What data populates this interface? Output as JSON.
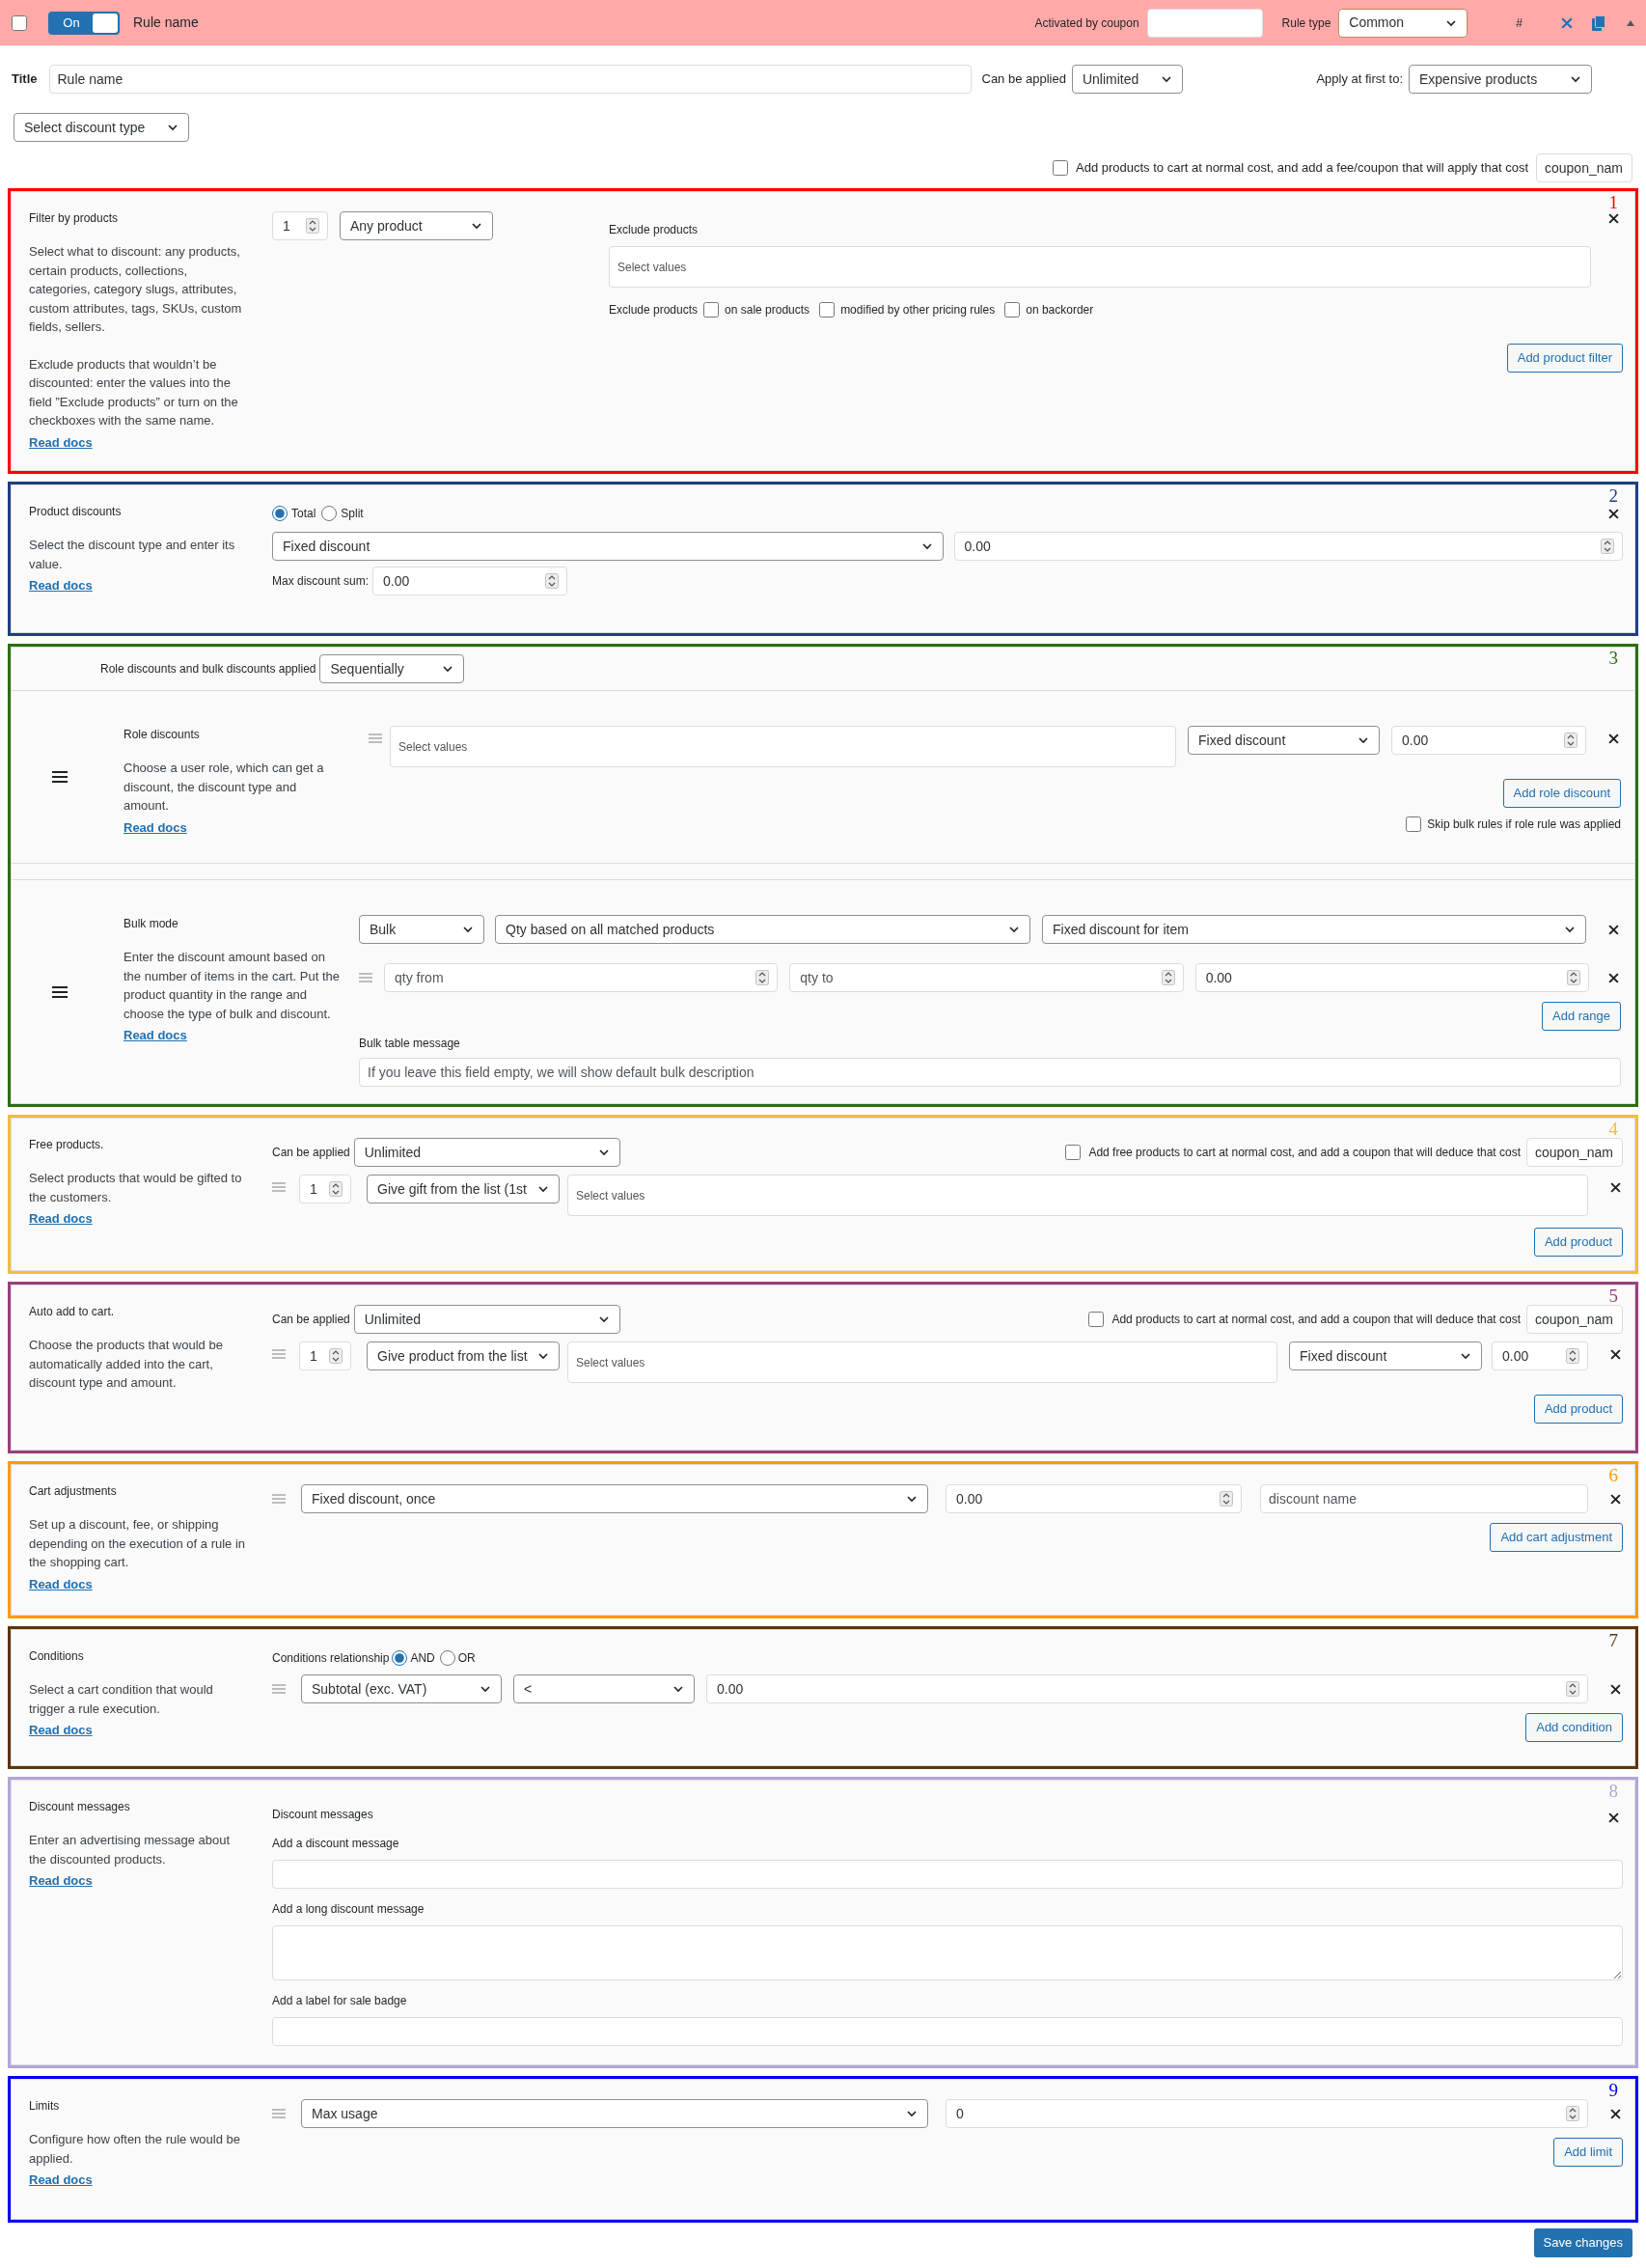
{
  "header": {
    "checked": false,
    "toggle": {
      "label": "On",
      "on": true
    },
    "rule_name": "Rule name",
    "coupon_label": "Activated by coupon",
    "rule_type_label": "Rule type",
    "rule_type": "Common",
    "hash": "#"
  },
  "title_row": {
    "label": "Title",
    "value": "Rule name",
    "can_be_applied_label": "Can be applied",
    "can_be_applied": "Unlimited",
    "apply_first_label": "Apply at first to:",
    "apply_first": "Expensive products"
  },
  "discount_type_select": "Select discount type",
  "cart_cost_option": {
    "checked": false,
    "label": "Add products to cart at normal cost, and add a fee/coupon that will apply that cost",
    "coupon_value": "coupon_nam"
  },
  "sections": [
    {
      "kind": "filter",
      "number": "1",
      "color": "#ff0000",
      "title": "Filter by products",
      "description": [
        "Select what to discount: any products, certain products, collections, categories, category slugs, attributes, custom attributes, tags, SKUs, custom fields, sellers.",
        "Exclude products that wouldn’t be discounted: enter the values into the field ”Exclude products” or turn on the checkboxes with the same name."
      ],
      "link": "Read docs",
      "quantity": "1",
      "product_select": "Any product",
      "exclude_label": "Exclude products",
      "exclude_field": {
        "placeholder": "Select values"
      },
      "exclude_options_label": "Exclude products",
      "exclude_options": [
        {
          "label": "on sale products",
          "checked": false
        },
        {
          "label": "modified by other pricing rules",
          "checked": false
        },
        {
          "label": "on backorder",
          "checked": false
        }
      ],
      "button": "Add product filter"
    },
    {
      "kind": "product_discount",
      "number": "2",
      "color": "#1e3f82",
      "title": "Product discounts",
      "description": [
        "Select the discount type and enter its value."
      ],
      "link": "Read docs",
      "modes": [
        {
          "label": "Total",
          "selected": true
        },
        {
          "label": "Split",
          "selected": false
        }
      ],
      "type_select": "Fixed discount",
      "amount": "0.00",
      "max_label": "Max discount sum:",
      "max_value": "0.00"
    },
    {
      "kind": "role_bulk",
      "number": "3",
      "color": "#2e6e12",
      "applied_label": "Role discounts and bulk discounts applied",
      "applied_select": "Sequentially",
      "role": {
        "title": "Role discounts",
        "description": [
          "Choose a user role, which can get a discount, the discount type and amount."
        ],
        "link": "Read docs",
        "roles_field": {
          "placeholder": "Select values"
        },
        "type_select": "Fixed discount",
        "amount": "0.00",
        "button": "Add role discount",
        "skip_option": {
          "label": "Skip bulk rules if role rule was applied",
          "checked": false
        }
      },
      "bulk": {
        "title": "Bulk mode",
        "description": [
          "Enter the discount amount based on the number of items in the cart. Put the product quantity in the range and choose the type of bulk and discount."
        ],
        "link": "Read docs",
        "mode_select": "Bulk",
        "qty_select": "Qty based on all matched products",
        "type_select": "Fixed discount for item",
        "range": {
          "from": {
            "placeholder": "qty from"
          },
          "to": {
            "placeholder": "qty to"
          },
          "amount": "0.00"
        },
        "button": "Add range",
        "message_label": "Bulk table message",
        "message_field": {
          "placeholder": "If you leave this field empty, we will show default bulk description"
        }
      }
    },
    {
      "kind": "free_products",
      "number": "4",
      "color": "#f0c035",
      "title": "Free products.",
      "description": [
        "Select products that would be gifted to the customers."
      ],
      "link": "Read docs",
      "applied_label": "Can be applied",
      "applied_select": "Unlimited",
      "cart_option": {
        "label": "Add free products to cart at normal cost, and add a coupon that will deduce that cost",
        "checked": false,
        "coupon_value": "coupon_nam"
      },
      "quantity": "1",
      "product_select": "Give gift from the list (1st",
      "products_field": {
        "placeholder": "Select values"
      },
      "button": "Add product"
    },
    {
      "kind": "auto_add",
      "number": "5",
      "color": "#9b3f7e",
      "title": "Auto add to cart.",
      "description": [
        "Choose the products that would be automatically added into the cart, discount type and amount."
      ],
      "applied_label": "Can be applied",
      "applied_select": "Unlimited",
      "cart_option": {
        "label": "Add products to cart at normal cost, and add a coupon that will deduce that cost",
        "checked": false,
        "coupon_value": "coupon_nam"
      },
      "quantity": "1",
      "product_select": "Give product from the list",
      "products_field": {
        "placeholder": "Select values"
      },
      "type_select": "Fixed discount",
      "amount": "0.00",
      "button": "Add product"
    },
    {
      "kind": "cart_adjustments",
      "number": "6",
      "color": "#ff9a00",
      "title": "Cart adjustments",
      "description": [
        "Set up a discount, fee, or shipping depending on the execution of a rule in the shopping cart."
      ],
      "link": "Read docs",
      "type_select": "Fixed discount, once",
      "amount": "0.00",
      "name_field": {
        "placeholder": "discount name"
      },
      "button": "Add cart adjustment"
    },
    {
      "kind": "conditions",
      "number": "7",
      "color": "#5e3408",
      "title": "Conditions",
      "description": [
        "Select a cart condition that would trigger a rule execution."
      ],
      "link": "Read docs",
      "relationship_label": "Conditions relationship",
      "relationships": [
        {
          "label": "AND",
          "selected": true
        },
        {
          "label": "OR",
          "selected": false
        }
      ],
      "subject_select": "Subtotal (exc. VAT)",
      "operator_select": "<",
      "value": "0.00",
      "button": "Add condition"
    },
    {
      "kind": "messages",
      "number": "8",
      "color": "#b3a5d9",
      "title": "Discount messages",
      "description": [
        "Enter an advertising message about the discounted products."
      ],
      "link": "Read docs",
      "heading": "Discount messages",
      "fields": [
        {
          "kind": "line",
          "label": "Add a discount message"
        },
        {
          "kind": "area",
          "label": "Add a long discount message"
        },
        {
          "kind": "line",
          "label": "Add a label for sale badge"
        }
      ]
    },
    {
      "kind": "limits",
      "number": "9",
      "color": "#0000ee",
      "title": "Limits",
      "description": [
        "Configure how often the rule would be applied."
      ],
      "link": "Read docs",
      "type_select": "Max usage",
      "value": "0",
      "button": "Add limit"
    }
  ],
  "save_button": "Save changes"
}
